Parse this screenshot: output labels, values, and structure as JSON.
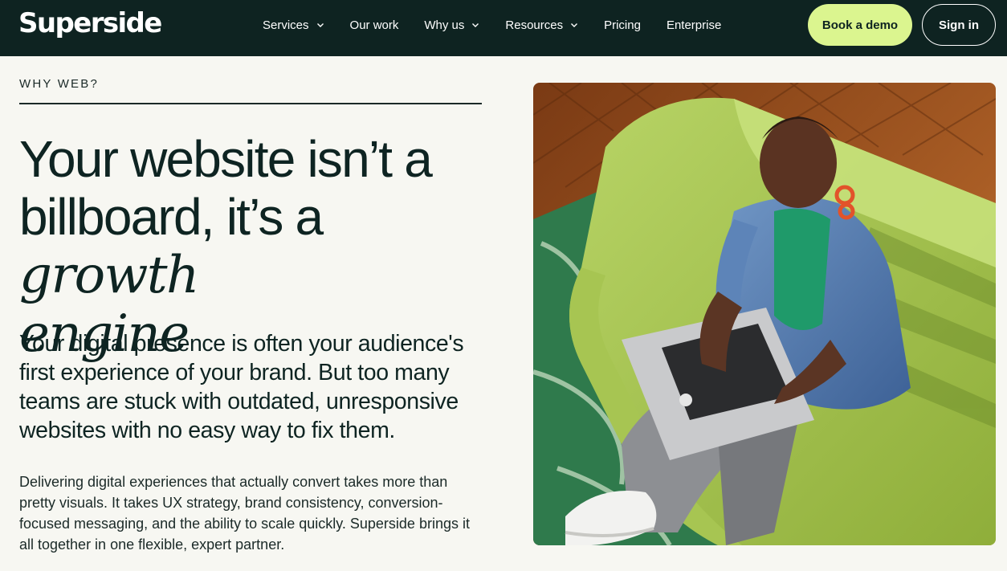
{
  "brand": {
    "logo_text": "Superside"
  },
  "nav": {
    "items": [
      {
        "label": "Services",
        "has_dropdown": true
      },
      {
        "label": "Our work",
        "has_dropdown": false
      },
      {
        "label": "Why us",
        "has_dropdown": true
      },
      {
        "label": "Resources",
        "has_dropdown": true
      },
      {
        "label": "Pricing",
        "has_dropdown": false
      },
      {
        "label": "Enterprise",
        "has_dropdown": false
      }
    ],
    "cta_label": "Book a demo",
    "signin_label": "Sign in"
  },
  "hero": {
    "eyebrow": "WHY WEB?",
    "headline_line1": "Your website isn’t a",
    "headline_line2_plain": "billboard, it’s a ",
    "headline_line2_italic": "growth",
    "headline_line3_italic": "engine",
    "lede": "Your digital presence is often your audience's first experience of your brand. But too many teams are stuck with outdated, unresponsive websites with no easy way to fix them.",
    "body": "Delivering digital experiences that actually convert takes more than pretty visuals. It takes UX strategy, brand consistency, conversion-focused messaging, and the ability to scale quickly. Superside brings it all together in one flexible, expert partner."
  },
  "colors": {
    "nav_bg": "#0e2321",
    "accent": "#dbf58f",
    "page_bg": "#f7f7f2",
    "text": "#0e2422"
  }
}
